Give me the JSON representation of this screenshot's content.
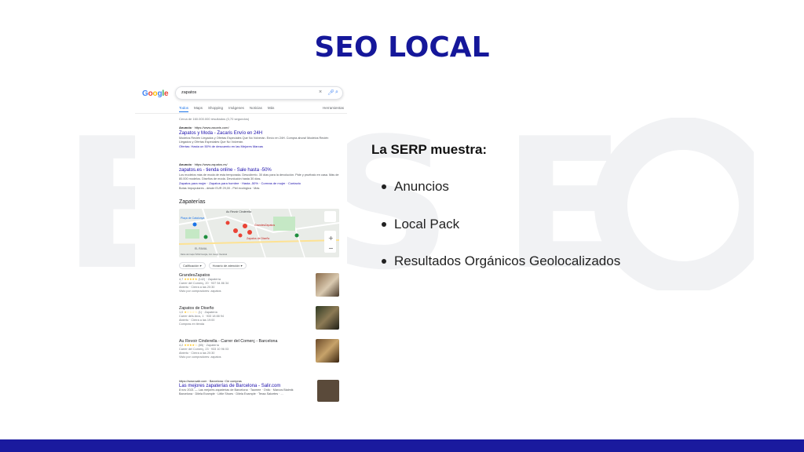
{
  "slide": {
    "title": "SEO LOCAL",
    "serp_heading": "La SERP muestra:",
    "bullets": [
      "Anuncios",
      "Local Pack",
      "Resultados Orgánicos Geolocalizados"
    ],
    "colors": {
      "accent": "#15179a",
      "bar": "#1a1a9e"
    }
  },
  "serp": {
    "logo": "Google",
    "query": "zapatos",
    "tabs": [
      "Todos",
      "Maps",
      "Shopping",
      "Imágenes",
      "Noticias",
      "Más"
    ],
    "tools": "Herramientas",
    "stats": "Cerca de 160.000.000 resultados (0,70 segundos)",
    "ads": [
      {
        "label": "Anuncio",
        "url": "https://www.zacaris.com/",
        "title": "Zapatos y Moda - Zacaris Envío en 24H",
        "text": "Modelos Recién Llegados y Ofertas Especiales Que No Volverán. Envío en 24H. Compra ahora! Modelos Recién Llegados y Ofertas Especiales Que No Volverán.",
        "links": "Ofertas: Hasta un 50% de descuento en las Mejores Marcas"
      },
      {
        "label": "Anuncio",
        "url": "https://www.zapatos.es/",
        "title": "zapatos.es - tienda online - Sale hasta -50%",
        "text": "Los modelos más de moda de esta temporada. Descúbrelo. 30 días para la devolución. Pide y pruébalo en casa. Más de 80.000 modelos. Diseños de moda. Devolución hasta 30 días.",
        "links": "Zapatos para mujer · Zapatos para hombre · Hasta -50% · Correas de mujer · Contacto",
        "extra": "Botas Impopulares - desde EUR 29,00 - Piel ecológica · Más"
      }
    ],
    "local_pack": {
      "title": "Zapaterías",
      "filters": [
        "Calificación",
        "Horario de atención"
      ],
      "map_labels": [
        "Au Revoir Cinderella",
        "GrandesZapatos",
        "Zapatos de Diseño",
        "EL RAVAL",
        "Plaça de Catalunya"
      ],
      "map_footer": "Datos del mapa ©2022 Google, Inst. Geogr. Nacional",
      "businesses": [
        {
          "name": "GrandesZapatos",
          "rating": "4,7",
          "stars": "★★★★★",
          "reviews": "(142)",
          "category": "Zapatería",
          "address": "Carrer del Comerç, 20 · 937 54 86 34",
          "hours": "Abierto · Cierra a las 20:30",
          "note": "Visto por compradores: zapatos"
        },
        {
          "name": "Zapatos de Diseño",
          "rating": "1,0",
          "stars": "★☆☆☆☆",
          "reviews": "(1)",
          "category": "Zapatería",
          "address": "Carrer dels Arcs, 1 · 933 18 88 94",
          "hours": "Abierto · Cierra a las 19:00",
          "note": "Compras en tienda"
        },
        {
          "name": "Au Revoir Cinderella - Carrer del Comerç - Barcelona",
          "rating": "4,2",
          "stars": "★★★★☆",
          "reviews": "(85)",
          "category": "Zapatería",
          "address": "Carrer del Comerç, 23 · 933 10 96 03",
          "hours": "Abierto · Cierra a las 20:30",
          "note": "Visto por compradores: zapatos"
        }
      ]
    },
    "organic": {
      "url": "https://www.salir.com · Barcelona › De compras",
      "title": "Las mejores zapaterías de Barcelona - Salir.com",
      "text": "8 nov 2021 — Las mejores zapaterías de Barcelona · Taomee · Onlic · Marcos Bialmik",
      "links": "Barcelona · Dilela Example · Little Shoes · Dilela Example · Teraa Salcetes · ..."
    }
  }
}
